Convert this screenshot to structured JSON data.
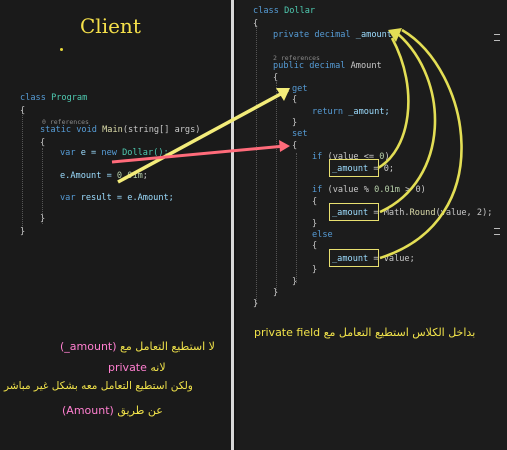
{
  "left": {
    "title": "Client",
    "code": {
      "class_kw": "class",
      "class_name": "Program",
      "open_brace": "{",
      "close_brace": "}",
      "refs": "0 references",
      "static_kw": "static",
      "void_kw": "void",
      "main_name": "Main",
      "main_params": "(string[] args)",
      "var_kw": "var",
      "e_decl_mid": " e = ",
      "new_kw": "new",
      "dollar_call": " Dollar();",
      "assign_left": "e.Amount = ",
      "assign_num": "0.01m",
      "assign_end": ";",
      "result_mid": " result = e.Amount;"
    },
    "notes": {
      "line1_prefix": "لا استطيع التعامل مع",
      "line1_field": "(_amount)",
      "line2_prefix": "لانه",
      "line2_private": "private",
      "line3": "ولكن استطيع التعامل معه بشكل غير مباشر",
      "line4_prefix": "عن طريق",
      "line4_prop": "(Amount)"
    }
  },
  "right": {
    "code": {
      "class_kw": "class",
      "class_name": "Dollar",
      "private_kw": "private",
      "decimal_kw": "decimal",
      "field_name": " _amount;",
      "refs": "2 references",
      "public_kw": "public",
      "prop_name": " Amount",
      "get_kw": "get",
      "return_kw": "return",
      "return_expr": " _amount;",
      "set_kw": "set",
      "if_kw": "if",
      "cond1_a": " (value <= ",
      "cond1_num": "0",
      "cond1_b": ")",
      "amount": "_amount",
      "assign0": " = 0;",
      "cond2_a": " (value % ",
      "cond2_num": "0.01m",
      "cond2_b": " > 0)",
      "round_a": " = Math.",
      "round_fn": "Round",
      "round_b": "(value, 2);",
      "else_kw": "else",
      "assign_value": " = value;"
    },
    "note": {
      "prefix": "بداخل الكلاس استطيع التعامل مع",
      "field": "private field"
    }
  },
  "colors": {
    "yellow_arrow": "#f3ec7a",
    "pink_arrow": "#ff6b7a",
    "swirl": "#e3de55",
    "note_text": "#f0e24a",
    "note_pink": "#ff7fd0"
  }
}
